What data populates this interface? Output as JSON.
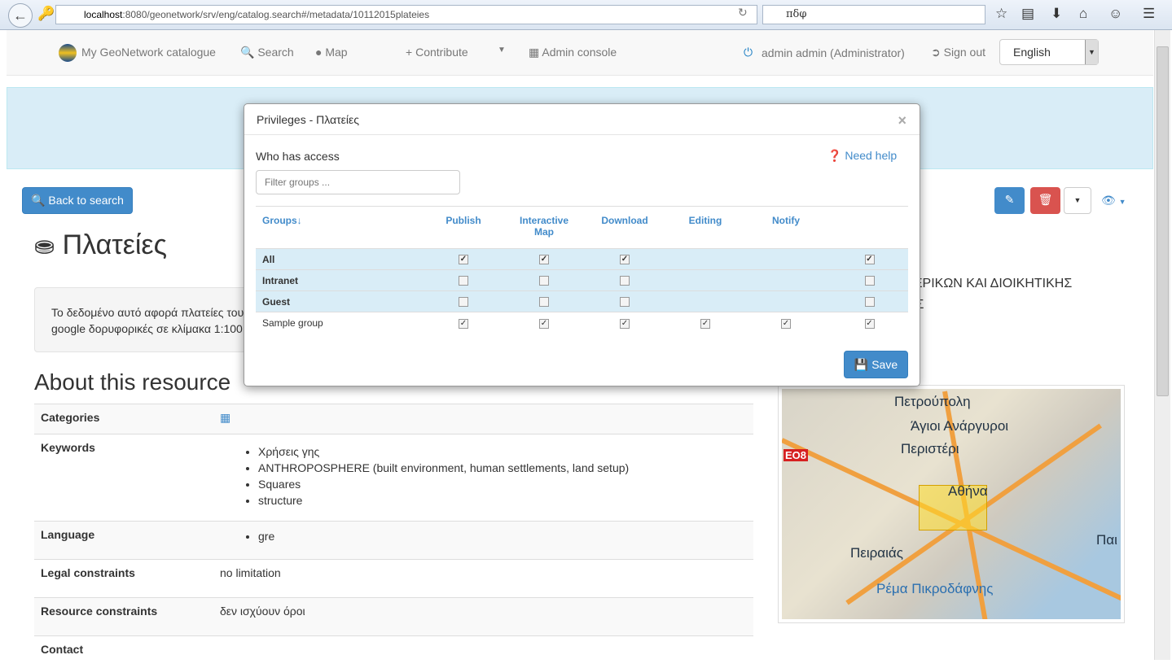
{
  "browser": {
    "url_host": "localhost",
    "url_rest": ":8080/geonetwork/srv/eng/catalog.search#/metadata/10112015plateies",
    "search_value": "πδφ"
  },
  "nav": {
    "brand": "My GeoNetwork catalogue",
    "search": "Search",
    "map": "Map",
    "contribute": "Contribute",
    "admin": "Admin console",
    "user": "admin admin (Administrator)",
    "signout": "Sign out",
    "language": "English"
  },
  "page": {
    "back": "Back to search",
    "title": "Πλατείες",
    "desc_line1": "Το δεδομένο αυτό αφορά πλατείες του",
    "desc_line2": "google δορυφορικές σε κλίμακα 1:100",
    "right_line1": "ΈΡΙΚΩΝ ΚΑΙ ΔΙΟΙΚΗΤΙΚΗΣ",
    "right_line2": "ΙΣ",
    "about": "About this resource"
  },
  "metadata": {
    "categories": "Categories",
    "keywords_label": "Keywords",
    "keywords": [
      "Χρήσεις γης",
      "ANTHROPOSPHERE (built environment, human settlements, land setup)",
      "Squares",
      "structure"
    ],
    "language_label": "Language",
    "language": "gre",
    "legal_label": "Legal constraints",
    "legal": "no limitation",
    "resource_label": "Resource constraints",
    "resource": "δεν ισχύουν όροι",
    "contact_label": "Contact"
  },
  "map_labels": [
    "Πετρούπολη",
    "Άγιοι Ανάργυροι",
    "Περιστέρι",
    "Αθήνα",
    "Πειραιάς",
    "Ρέμα Πικροδάφνης",
    "ΕΟ8",
    "Παι"
  ],
  "modal": {
    "title": "Privileges - Πλατείες",
    "who": "Who has access",
    "help": "Need help",
    "filter_placeholder": "Filter groups ...",
    "save": "Save",
    "columns": [
      "Groups",
      "Publish",
      "Interactive Map",
      "Download",
      "Editing",
      "Notify",
      ""
    ],
    "rows": [
      {
        "name": "All",
        "bold": true,
        "checks": [
          true,
          true,
          true,
          null,
          null,
          true
        ]
      },
      {
        "name": "Intranet",
        "bold": true,
        "checks": [
          false,
          false,
          false,
          null,
          null,
          false
        ]
      },
      {
        "name": "Guest",
        "bold": true,
        "checks": [
          false,
          false,
          false,
          null,
          null,
          false
        ]
      },
      {
        "name": "Sample group",
        "bold": false,
        "checks": [
          true,
          true,
          true,
          true,
          true,
          true
        ]
      }
    ]
  },
  "colors": {
    "primary": "#428bca",
    "danger": "#d9534f",
    "info_bg": "#d9edf7"
  }
}
